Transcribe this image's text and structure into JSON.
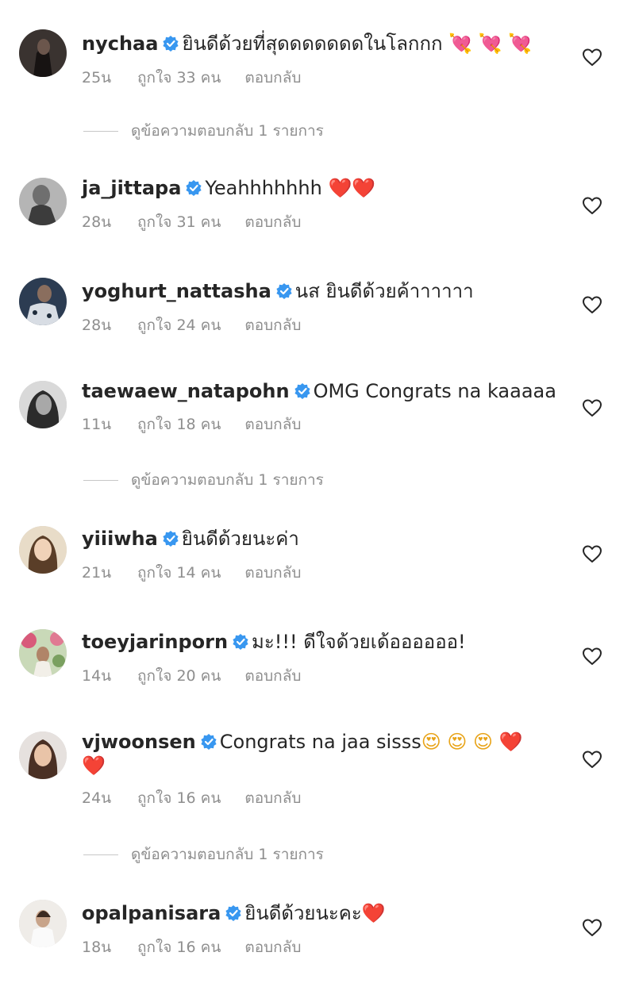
{
  "colors": {
    "text": "#262626",
    "secondary": "#8e8e8e",
    "verified": "#3897f0",
    "heart": "#e0102b"
  },
  "comments": [
    {
      "username": "nycha a",
      "text": "ยินดีด้วยที่สุดดดดดดดในโลกกก",
      "emoji": "💘 💘 💘",
      "time": "25น",
      "likes": "ถูกใจ 33 คน",
      "reply_label": "ตอบกลับ",
      "view_replies": "ดูข้อความตอบกลับ 1 รายการ"
    },
    {
      "username": "ja_jittapa",
      "text": "Yeahhhhhhh",
      "emoji": "❤️❤️",
      "time": "28น",
      "likes": "ถูกใจ 31 คน",
      "reply_label": "ตอบกลับ"
    },
    {
      "username": "yoghurt_nattasha",
      "text": "นส ยินดีด้วยค้าาาาาา",
      "emoji": "",
      "time": "28น",
      "likes": "ถูกใจ 24 คน",
      "reply_label": "ตอบกลับ"
    },
    {
      "username": "taewaew_natapohn",
      "text": "OMG Congrats na kaaaaa",
      "emoji": "",
      "time": "11น",
      "likes": "ถูกใจ 18 คน",
      "reply_label": "ตอบกลับ",
      "view_replies": "ดูข้อความตอบกลับ 1 รายการ"
    },
    {
      "username": "yiiiwha",
      "text": "ยินดีด้วยนะค่า",
      "emoji": "",
      "time": "21น",
      "likes": "ถูกใจ 14 คน",
      "reply_label": "ตอบกลับ"
    },
    {
      "username": "toeyjarinporn",
      "text": "มะ!!! ดีใจด้วยเด้ออออออ!",
      "emoji": "",
      "time": "14น",
      "likes": "ถูกใจ 20 คน",
      "reply_label": "ตอบกลับ"
    },
    {
      "username": "vjwoonsen",
      "text": "Congrats na jaa sisss",
      "emoji": "😍 😍 😍 ❤️",
      "emoji2": "❤️",
      "time": "24น",
      "likes": "ถูกใจ 16 คน",
      "reply_label": "ตอบกลับ",
      "view_replies": "ดูข้อความตอบกลับ 1 รายการ"
    },
    {
      "username": "opalpanisara",
      "text": "ยินดีด้วยนะคะ",
      "emoji": "❤️",
      "time": "18น",
      "likes": "ถูกใจ 16 คน",
      "reply_label": "ตอบกลับ"
    }
  ],
  "icons": {
    "like": "heart-outline-icon",
    "verified": "verified-badge-icon"
  }
}
